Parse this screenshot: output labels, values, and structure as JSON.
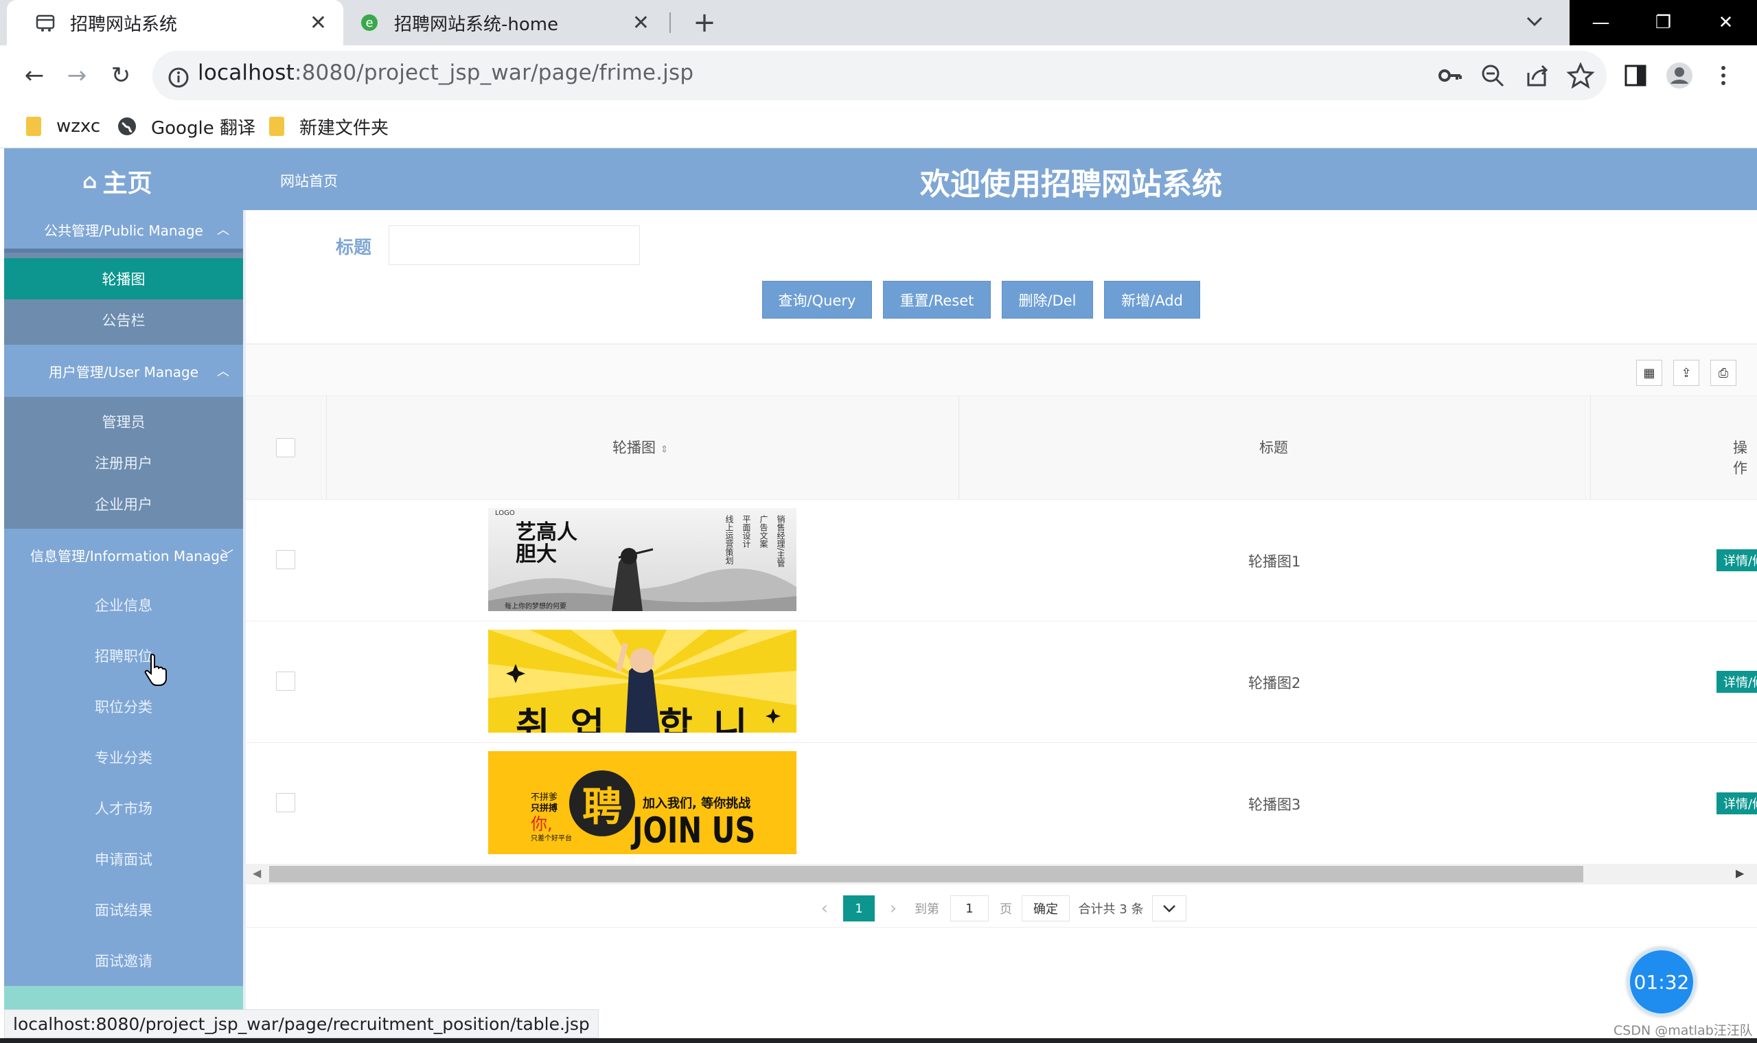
{
  "browser": {
    "tabs": [
      {
        "title": "招聘网站系统",
        "active": true
      },
      {
        "title": "招聘网站系统-home",
        "active": false
      }
    ],
    "url_host": "localhost",
    "url_path": ":8080/project_jsp_war/page/frime.jsp",
    "bookmarks": [
      "wzxc",
      "Google 翻译",
      "新建文件夹"
    ],
    "status_url": "localhost:8080/project_jsp_war/page/recruitment_position/table.jsp"
  },
  "header": {
    "home": "主页",
    "site_link": "网站首页",
    "title": "欢迎使用招聘网站系统"
  },
  "sidebar": {
    "groups": [
      {
        "label": "公共管理/Public Manage",
        "items": [
          "轮播图",
          "公告栏"
        ]
      },
      {
        "label": "用户管理/User Manage",
        "items": [
          "管理员",
          "注册用户",
          "企业用户"
        ]
      },
      {
        "label": "信息管理/Information Manage",
        "items": [
          "企业信息",
          "招聘职位",
          "职位分类",
          "专业分类",
          "人才市场",
          "申请面试",
          "面试结果",
          "面试邀请"
        ]
      }
    ],
    "active_item": "轮播图"
  },
  "search": {
    "label": "标题",
    "value": "",
    "buttons": {
      "query": "查询/Query",
      "reset": "重置/Reset",
      "delete": "删除/Del",
      "add": "新增/Add"
    }
  },
  "table": {
    "headers": {
      "image": "轮播图",
      "title": "标题",
      "ops": "操作"
    },
    "rows": [
      {
        "title": "轮播图1",
        "action": "详情/修改"
      },
      {
        "title": "轮播图2",
        "action": "详情/修改"
      },
      {
        "title": "轮播图3",
        "action": "详情/修改"
      }
    ]
  },
  "banners": {
    "b1_big": "艺高人胆大",
    "b1_logo": "LOGO",
    "b1_lines": [
      "销售经理/主管",
      "广告文案",
      "平面设计",
      "线上运营策划"
    ],
    "b1_small": "每上你的梦想的何要",
    "b2_text": "취업 합니다",
    "b3_left": [
      "不拼爹",
      "只拼搏",
      "你,",
      "只差个好平台"
    ],
    "b3_icon": "聘",
    "b3_right1": "加入我们, 等你挑战",
    "b3_right2": "JOIN US"
  },
  "pager": {
    "current": "1",
    "goto_label": "到第",
    "goto_value": "1",
    "page_unit": "页",
    "confirm": "确定",
    "total": "合计共 3 条"
  },
  "timer": "01:32",
  "watermark": "CSDN @matlab汪汪队",
  "colors": {
    "header": "#7fa7d5",
    "active": "#0d968f",
    "button": "#6e9fd4"
  }
}
